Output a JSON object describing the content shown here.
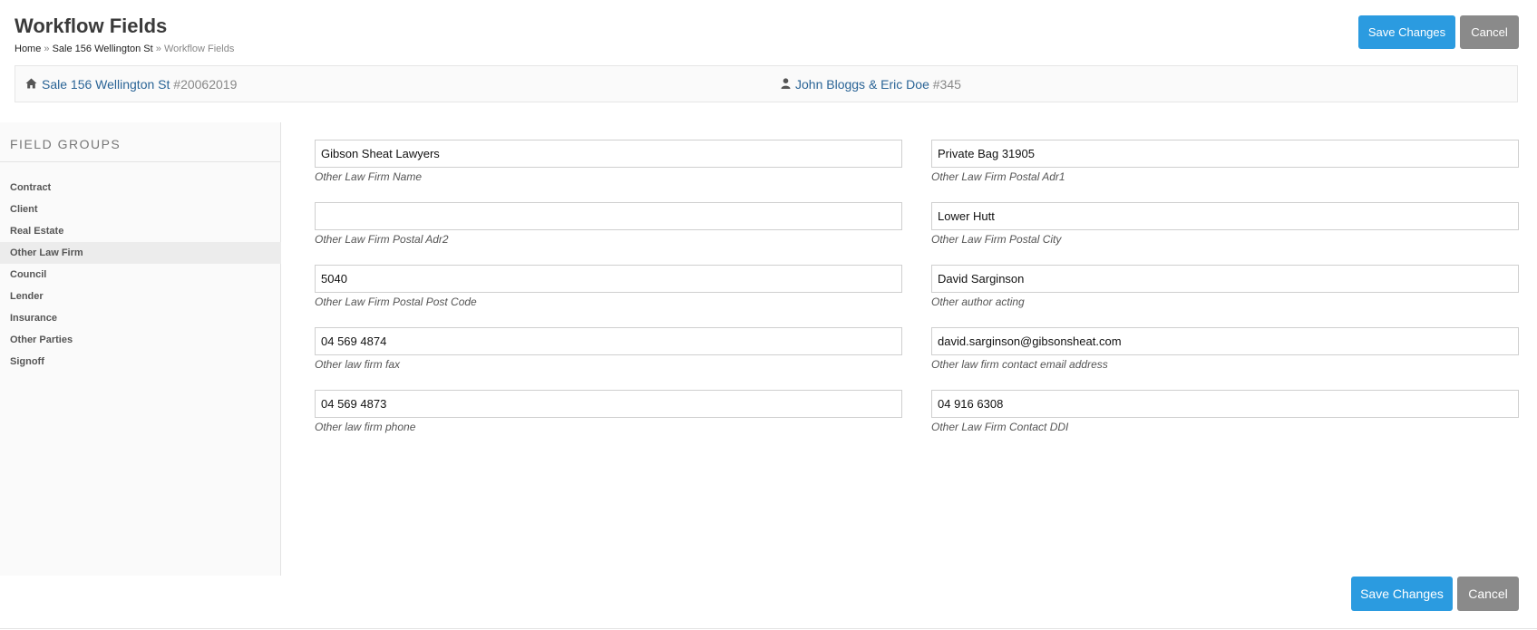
{
  "header": {
    "title": "Workflow Fields",
    "breadcrumb": {
      "home": "Home",
      "sep1": "»",
      "parent": "Sale 156 Wellington St",
      "sep2": "»",
      "current": "Workflow Fields"
    },
    "save_label": "Save Changes",
    "cancel_label": "Cancel"
  },
  "info_bar": {
    "property": {
      "icon": "home-icon",
      "name": "Sale 156 Wellington St",
      "number": "#20062019"
    },
    "client": {
      "icon": "user-icon",
      "name": "John Bloggs & Eric Doe",
      "number": "#345"
    }
  },
  "sidebar": {
    "heading": "FIELD GROUPS",
    "items": [
      {
        "label": "Contract",
        "active": false
      },
      {
        "label": "Client",
        "active": false
      },
      {
        "label": "Real Estate",
        "active": false
      },
      {
        "label": "Other Law Firm",
        "active": true
      },
      {
        "label": "Council",
        "active": false
      },
      {
        "label": "Lender",
        "active": false
      },
      {
        "label": "Insurance",
        "active": false
      },
      {
        "label": "Other Parties",
        "active": false
      },
      {
        "label": "Signoff",
        "active": false
      }
    ]
  },
  "fields": [
    {
      "value": "Gibson Sheat Lawyers",
      "label": "Other Law Firm Name"
    },
    {
      "value": "Private Bag 31905",
      "label": "Other Law Firm Postal Adr1"
    },
    {
      "value": "",
      "label": "Other Law Firm Postal Adr2"
    },
    {
      "value": "Lower Hutt",
      "label": "Other Law Firm Postal City"
    },
    {
      "value": "5040",
      "label": "Other Law Firm Postal Post Code"
    },
    {
      "value": "David Sarginson",
      "label": "Other author acting"
    },
    {
      "value": "04 569 4874",
      "label": "Other law firm fax"
    },
    {
      "value": "david.sarginson@gibsonsheat.com",
      "label": "Other law firm contact email address"
    },
    {
      "value": "04 569 4873",
      "label": "Other law firm phone"
    },
    {
      "value": "04 916 6308",
      "label": "Other Law Firm Contact DDI"
    }
  ],
  "footer": {
    "save_label": "Save Changes",
    "cancel_label": "Cancel"
  },
  "colors": {
    "accent": "#2b9be0",
    "cancel": "#8a8a8a",
    "link": "#2a6496"
  }
}
